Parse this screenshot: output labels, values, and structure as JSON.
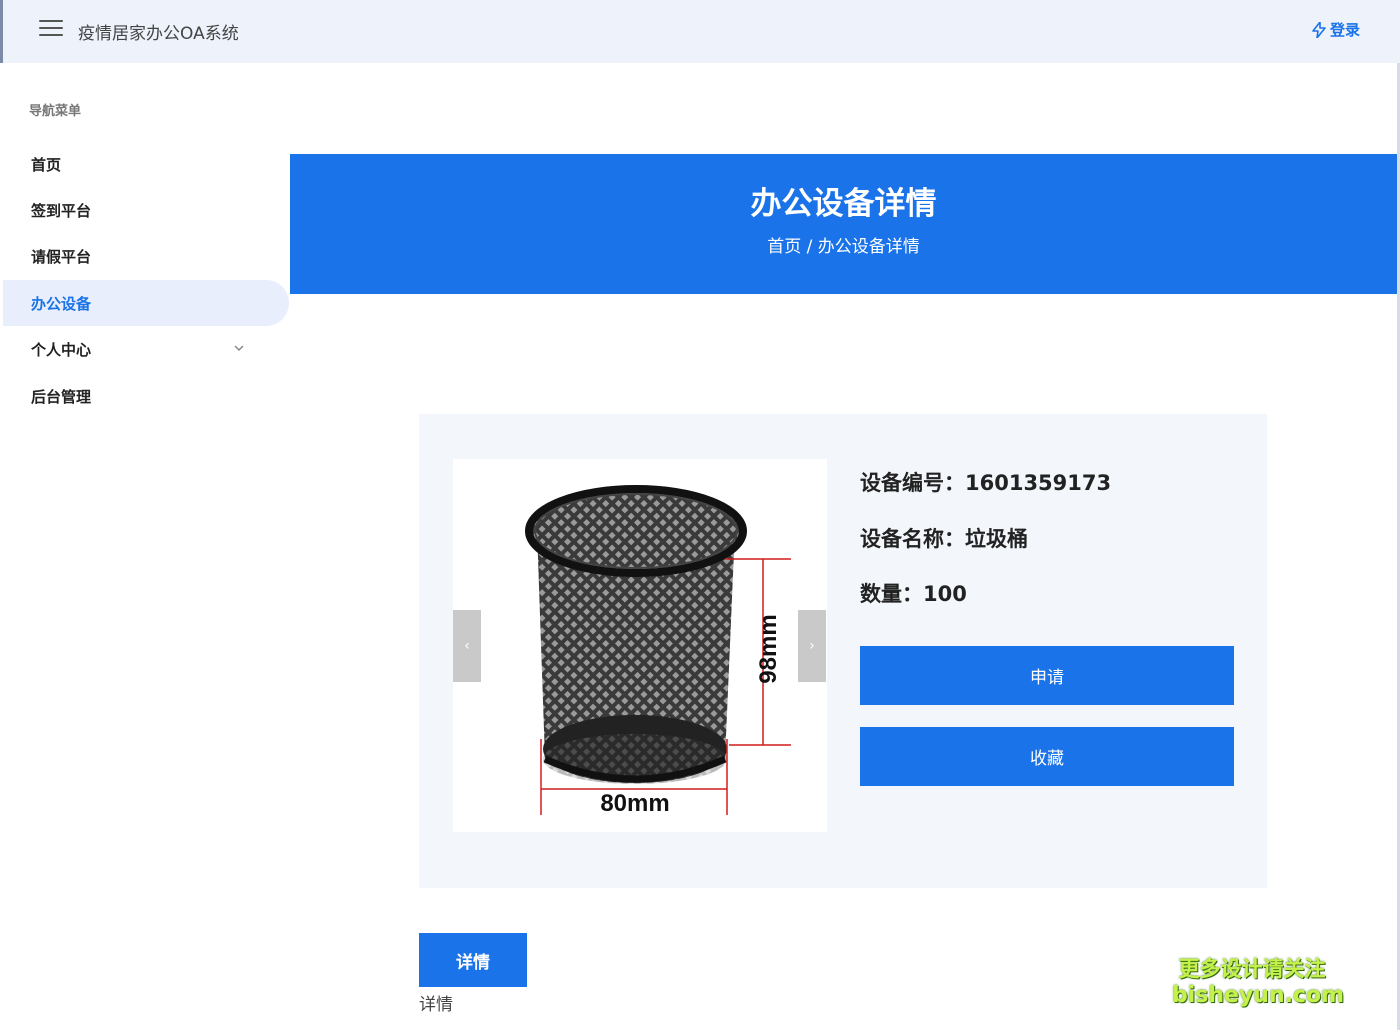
{
  "header": {
    "app_title": "疫情居家办公OA系统",
    "login_label": "登录"
  },
  "sidebar": {
    "header": "导航菜单",
    "items": [
      {
        "label": "首页"
      },
      {
        "label": "签到平台"
      },
      {
        "label": "请假平台"
      },
      {
        "label": "办公设备",
        "active": true
      },
      {
        "label": "个人中心",
        "has_submenu": true
      },
      {
        "label": "后台管理"
      }
    ]
  },
  "hero": {
    "title": "办公设备详情",
    "breadcrumb": "首页 / 办公设备详情"
  },
  "detail": {
    "image": {
      "description": "black mesh pen holder",
      "width_label": "80mm",
      "height_label": "98mm"
    },
    "code_text": "设备编号：1601359173",
    "name_text": "设备名称：垃圾桶",
    "qty_text": "数量：100",
    "apply_label": "申请",
    "favorite_label": "收藏",
    "prev_icon": "‹",
    "next_icon": "›"
  },
  "tabs": {
    "detail_tab_label": "详情",
    "detail_content": "详情"
  },
  "watermark": {
    "line1": "更多设计请关注",
    "line2": "bisheyun.com"
  },
  "colors": {
    "accent": "#1a73e8",
    "header_bg": "#eef2fb",
    "card_bg": "#f3f7fc"
  }
}
